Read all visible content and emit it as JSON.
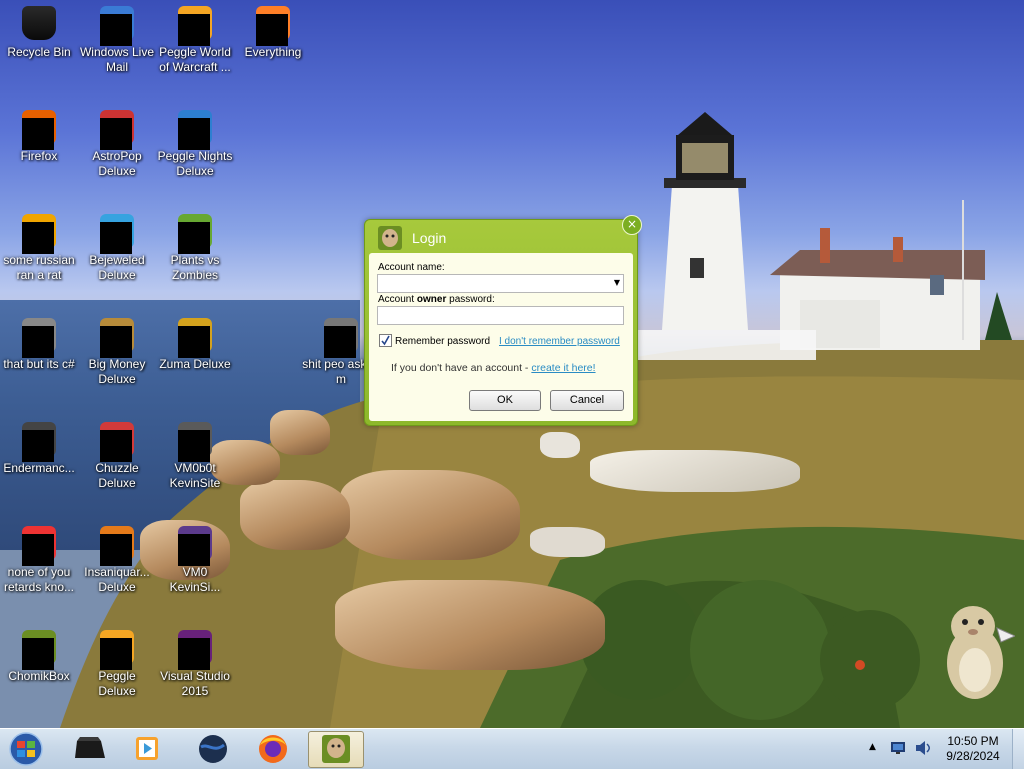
{
  "desktop": {
    "icons": [
      {
        "label": "Recycle Bin",
        "icon": "recycle-bin-icon"
      },
      {
        "label": "Windows Live Mail",
        "icon": "mail-icon"
      },
      {
        "label": "Peggle World of Warcraft ...",
        "icon": "peggle-wow-icon"
      },
      {
        "label": "Everything",
        "icon": "search-icon"
      },
      {
        "label": "Firefox",
        "icon": "firefox-icon"
      },
      {
        "label": "AstroPop Deluxe",
        "icon": "astropop-icon"
      },
      {
        "label": "Peggle Nights Deluxe",
        "icon": "peggle-nights-icon"
      },
      {
        "label": "some russian ran a rat",
        "icon": "app-icon"
      },
      {
        "label": "Bejeweled Deluxe",
        "icon": "bejeweled-icon"
      },
      {
        "label": "Plants vs Zombies",
        "icon": "pvz-icon"
      },
      {
        "label": "that but its c#",
        "icon": "app-icon"
      },
      {
        "label": "Big Money Deluxe",
        "icon": "big-money-icon"
      },
      {
        "label": "Zuma Deluxe",
        "icon": "zuma-icon"
      },
      {
        "label": "shit peo asked m",
        "icon": "app-icon"
      },
      {
        "label": "Endermanc...",
        "icon": "app-icon"
      },
      {
        "label": "Chuzzle Deluxe",
        "icon": "chuzzle-icon"
      },
      {
        "label": "VM0b0t KevinSite",
        "icon": "vm-icon"
      },
      {
        "label": "none of you retards kno...",
        "icon": "app-icon"
      },
      {
        "label": "Insaniquar... Deluxe",
        "icon": "insaniquarium-icon"
      },
      {
        "label": "VM0 KevinSi...",
        "icon": "vm-icon"
      },
      {
        "label": "ChomikBox",
        "icon": "chomikbox-icon"
      },
      {
        "label": "Peggle Deluxe",
        "icon": "peggle-icon"
      },
      {
        "label": "Visual Studio 2015",
        "icon": "visual-studio-icon"
      }
    ]
  },
  "dialog": {
    "title": "Login",
    "account_name_label": "Account name:",
    "password_label_pre": "Account ",
    "password_label_bold": "owner",
    "password_label_post": " password:",
    "remember_label": "Remember password",
    "remember_checked": true,
    "forgot_link": "I don't remember password",
    "no_account_text": "If you don't have an account - ",
    "create_link": "create it here!",
    "ok_label": "OK",
    "cancel_label": "Cancel",
    "close_glyph": "×"
  },
  "taskbar": {
    "time": "10:50 PM",
    "date": "9/28/2024",
    "buttons": [
      "start-orb-icon",
      "terminal-icon",
      "media-player-icon",
      "globe-icon",
      "firefox-icon",
      "chomikbox-icon"
    ]
  },
  "colors": {
    "dialog_green": "#9dc236",
    "link": "#2a8cc4",
    "panel": "#fdfde9"
  }
}
